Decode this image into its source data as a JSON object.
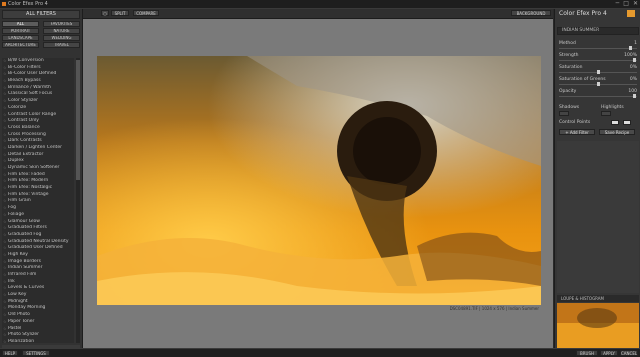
{
  "window": {
    "title": "Color Efex Pro 4",
    "controls": [
      "─",
      "□",
      "✕"
    ]
  },
  "left_panel": {
    "header": "ALL FILTERS",
    "categories": [
      {
        "label": "ALL",
        "active": true
      },
      {
        "label": "FAVORITES",
        "active": false
      },
      {
        "label": "PORTRAIT",
        "active": false
      },
      {
        "label": "NATURE",
        "active": false
      },
      {
        "label": "LANDSCAPE",
        "active": false
      },
      {
        "label": "WEDDING",
        "active": false
      },
      {
        "label": "ARCHITECTURE",
        "active": false
      },
      {
        "label": "TRAVEL",
        "active": false
      }
    ],
    "filters": [
      "B/W Conversion",
      "Bi-Color Filters",
      "Bi-Color User Defined",
      "Bleach Bypass",
      "Brilliance / Warmth",
      "Classical Soft Focus",
      "Color Stylizer",
      "Colorize",
      "Contrast Color Range",
      "Contrast Only",
      "Cross Balance",
      "Cross Processing",
      "Dark Contrasts",
      "Darken / Lighten Center",
      "Detail Extractor",
      "Duplex",
      "Dynamic Skin Softener",
      "Film Efex: Faded",
      "Film Efex: Modern",
      "Film Efex: Nostalgic",
      "Film Efex: Vintage",
      "Film Grain",
      "Fog",
      "Foliage",
      "Glamour Glow",
      "Graduated Filters",
      "Graduated Fog",
      "Graduated Neutral Density",
      "Graduated User Defined",
      "High Key",
      "Image Borders",
      "Indian Summer",
      "Infrared Film",
      "Ink",
      "Levels & Curves",
      "Low Key",
      "Midnight",
      "Monday Morning",
      "Old Photo",
      "Paper Toner",
      "Pastel",
      "Photo Stylizer",
      "Polarization"
    ]
  },
  "toolbar": {
    "view_buttons": [
      "◻",
      "SPLIT",
      "COMPARE"
    ],
    "right_label": "BACKGROUND"
  },
  "canvas": {
    "caption": "DSC04891.TIF  |  1024 x 576  |  Indian Summer"
  },
  "right_panel": {
    "title": "Color Efex Pro 4",
    "section": "INDIAN SUMMER",
    "sliders": [
      {
        "label": "Method",
        "value": "1"
      },
      {
        "label": "Strength",
        "value": "100%"
      },
      {
        "label": "Saturation",
        "value": "0%"
      },
      {
        "label": "Saturation of Greens",
        "value": "0%"
      },
      {
        "label": "Opacity",
        "value": "100"
      }
    ],
    "shadows_label": "Shadows",
    "highlights_label": "Highlights",
    "control_points_label": "Control Points",
    "btn_add_filter": "+ Add Filter",
    "btn_save_recipe": "Save Recipe",
    "loupe_label": "LOUPE & HISTOGRAM"
  },
  "bottom_bar": {
    "left_buttons": [
      "HELP",
      "SETTINGS"
    ],
    "right_buttons": [
      "BRUSH",
      "APPLY",
      "CANCEL"
    ]
  },
  "colors": {
    "accent": "#e07a1f",
    "panel_bg": "#323232",
    "canvas_bg": "#7a7a7a"
  }
}
